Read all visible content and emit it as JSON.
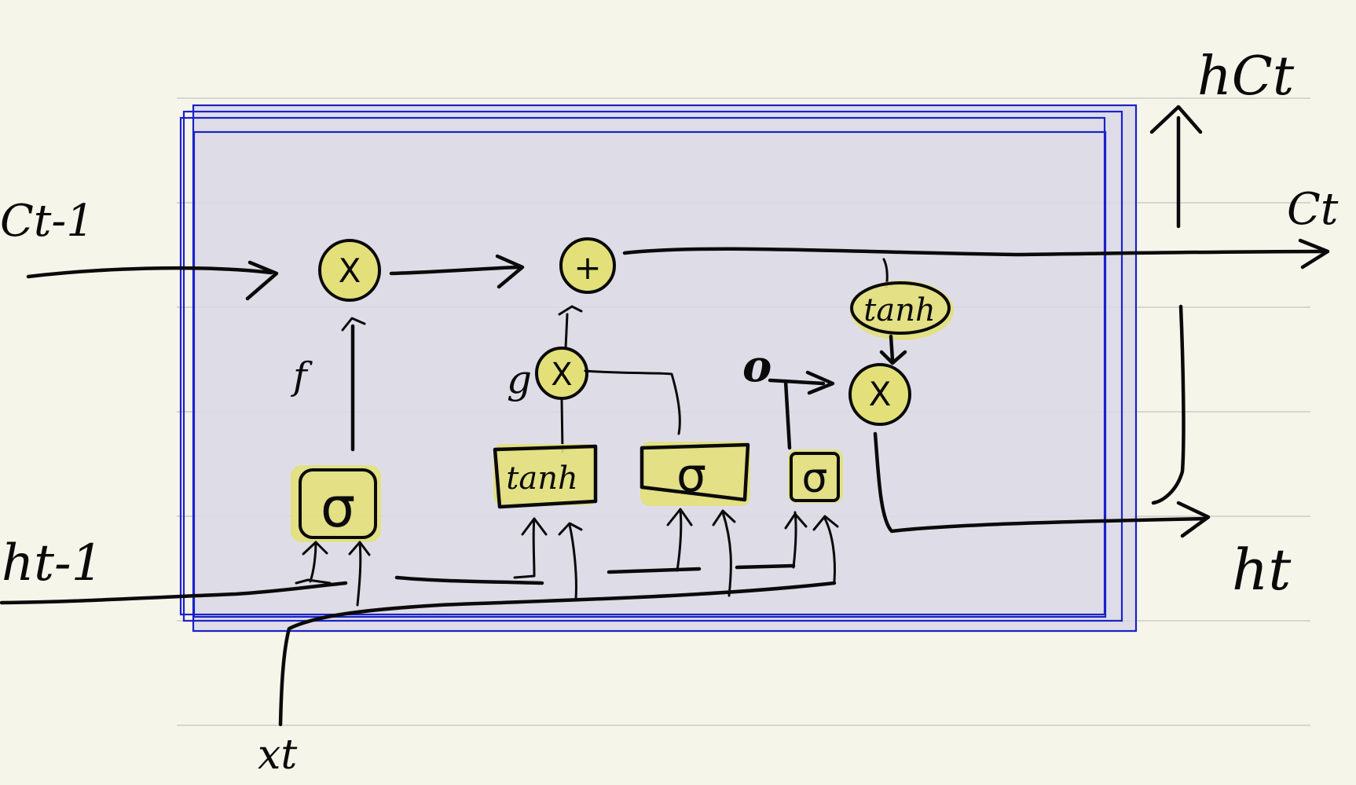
{
  "diagram": {
    "inputs": {
      "cell_prev": "Ct-1",
      "hidden_prev": "ht-1",
      "x_input": "xt"
    },
    "outputs": {
      "cell_out": "Ct",
      "hidden_up": "hCt",
      "hidden_out": "ht"
    },
    "gate_labels": {
      "forget": "f",
      "candidate": "g",
      "output": "o"
    },
    "operators": {
      "multiply": "X",
      "add": "+"
    },
    "activations": {
      "forget_gate": "σ",
      "candidate_layer": "tanh",
      "input_gate": "σ",
      "output_gate": "σ",
      "cell_tanh": "tanh"
    },
    "colors": {
      "paper": "#f6f5ea",
      "cell_frame": "#1a22c8",
      "highlight": "#e3e07a",
      "ink": "#0a0a0a"
    }
  }
}
